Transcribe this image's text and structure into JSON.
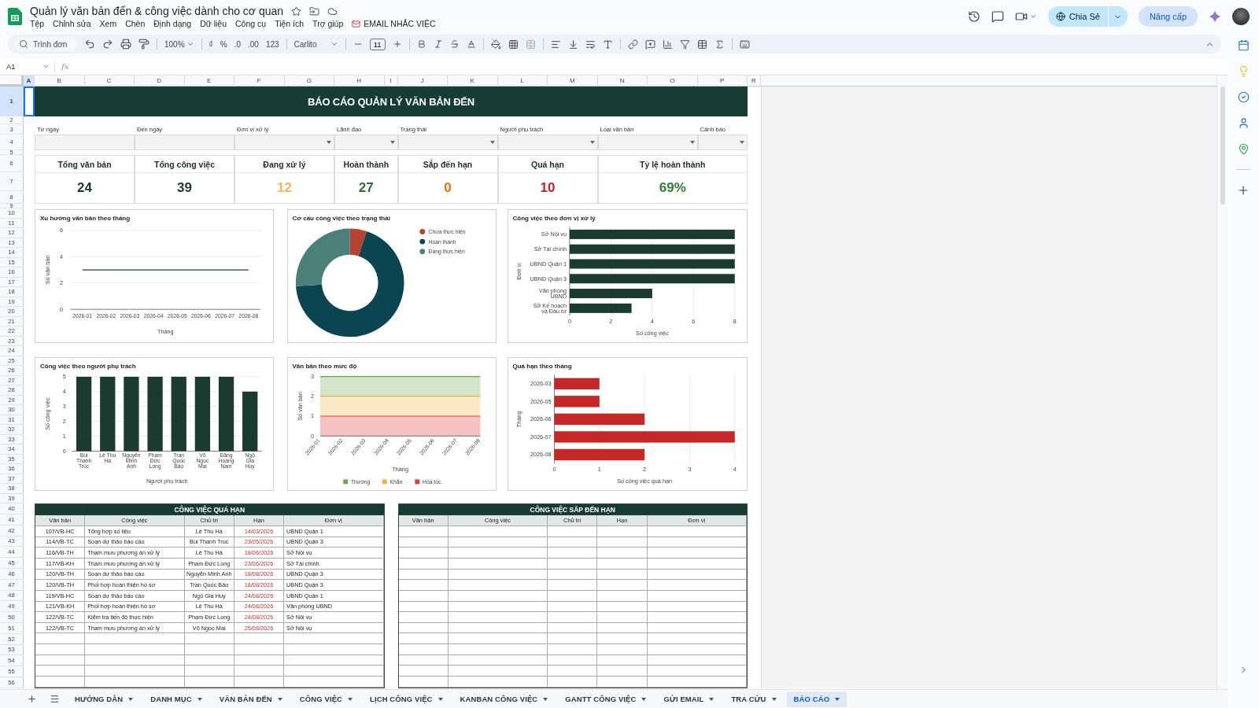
{
  "app": {
    "title": "Quản lý văn bản đến & công việc dành cho cơ quan",
    "share_label": "Chia Sẻ",
    "upgrade_label": "Nâng cấp"
  },
  "menu": [
    {
      "label": "Tệp",
      "kind": "menu"
    },
    {
      "label": "Chỉnh sửa",
      "kind": "menu"
    },
    {
      "label": "Xem",
      "kind": "menu"
    },
    {
      "label": "Chèn",
      "kind": "menu"
    },
    {
      "label": "Định dạng",
      "kind": "menu"
    },
    {
      "label": "Dữ liệu",
      "kind": "menu"
    },
    {
      "label": "Công cụ",
      "kind": "menu"
    },
    {
      "label": "Tiện ích",
      "kind": "menu"
    },
    {
      "label": "Trợ giúp",
      "kind": "menu"
    },
    {
      "label": "EMAIL NHẮC VIỆC",
      "kind": "addon"
    }
  ],
  "toolbar": {
    "search_placeholder": "Trình đơn",
    "zoom": "100%",
    "currency": "₫",
    "percent": "%",
    "decrease_decimals": ".0",
    "increase_decimals": ".00",
    "number_format": "123",
    "font": "Carlito",
    "font_size": "11"
  },
  "formula_bar": {
    "cell_ref": "A1",
    "fx": "fx"
  },
  "columns": [
    {
      "label": "A",
      "selected": true
    },
    {
      "label": "B",
      "selected": false
    },
    {
      "label": "C",
      "selected": false
    },
    {
      "label": "D",
      "selected": false
    },
    {
      "label": "E",
      "selected": false
    },
    {
      "label": "F",
      "selected": false
    },
    {
      "label": "G",
      "selected": false
    },
    {
      "label": "H",
      "selected": false
    },
    {
      "label": "I",
      "selected": false
    },
    {
      "label": "J",
      "selected": false
    },
    {
      "label": "K",
      "selected": false
    },
    {
      "label": "L",
      "selected": false
    },
    {
      "label": "M",
      "selected": false
    },
    {
      "label": "N",
      "selected": false
    },
    {
      "label": "O",
      "selected": false
    },
    {
      "label": "P",
      "selected": false
    },
    {
      "label": "R",
      "selected": false
    }
  ],
  "rows": [
    {
      "label": "1",
      "selected": true
    },
    {
      "label": "2",
      "selected": false
    },
    {
      "label": "3",
      "selected": false
    },
    {
      "label": "4",
      "selected": false
    },
    {
      "label": "5",
      "selected": false
    },
    {
      "label": "6",
      "selected": false
    },
    {
      "label": "7",
      "selected": false
    },
    {
      "label": "8",
      "selected": false
    },
    {
      "label": "9",
      "selected": false
    },
    {
      "label": "10",
      "selected": false
    },
    {
      "label": "11",
      "selected": false
    },
    {
      "label": "12",
      "selected": false
    },
    {
      "label": "13",
      "selected": false
    },
    {
      "label": "14",
      "selected": false
    },
    {
      "label": "15",
      "selected": false
    },
    {
      "label": "16",
      "selected": false
    },
    {
      "label": "17",
      "selected": false
    },
    {
      "label": "18",
      "selected": false
    },
    {
      "label": "19",
      "selected": false
    },
    {
      "label": "20",
      "selected": false
    },
    {
      "label": "21",
      "selected": false
    },
    {
      "label": "22",
      "selected": false
    },
    {
      "label": "23",
      "selected": false
    },
    {
      "label": "24",
      "selected": false
    },
    {
      "label": "25",
      "selected": false
    },
    {
      "label": "26",
      "selected": false
    },
    {
      "label": "27",
      "selected": false
    },
    {
      "label": "28",
      "selected": false
    },
    {
      "label": "29",
      "selected": false
    },
    {
      "label": "30",
      "selected": false
    },
    {
      "label": "31",
      "selected": false
    },
    {
      "label": "32",
      "selected": false
    },
    {
      "label": "33",
      "selected": false
    },
    {
      "label": "34",
      "selected": false
    },
    {
      "label": "35",
      "selected": false
    },
    {
      "label": "36",
      "selected": false
    },
    {
      "label": "37",
      "selected": false
    },
    {
      "label": "38",
      "selected": false
    },
    {
      "label": "39",
      "selected": false
    },
    {
      "label": "40",
      "selected": false
    },
    {
      "label": "41",
      "selected": false
    },
    {
      "label": "42",
      "selected": false
    },
    {
      "label": "43",
      "selected": false
    },
    {
      "label": "44",
      "selected": false
    },
    {
      "label": "45",
      "selected": false
    },
    {
      "label": "46",
      "selected": false
    },
    {
      "label": "47",
      "selected": false
    },
    {
      "label": "48",
      "selected": false
    },
    {
      "label": "49",
      "selected": false
    },
    {
      "label": "50",
      "selected": false
    },
    {
      "label": "51",
      "selected": false
    },
    {
      "label": "52",
      "selected": false
    },
    {
      "label": "53",
      "selected": false
    },
    {
      "label": "54",
      "selected": false
    },
    {
      "label": "55",
      "selected": false
    },
    {
      "label": "56",
      "selected": false
    }
  ],
  "report": {
    "title": "BÁO CÁO QUẢN LÝ VĂN BẢN ĐẾN",
    "filters": [
      {
        "label": "Từ ngày",
        "kind": "text"
      },
      {
        "label": "Đến ngày",
        "kind": "text"
      },
      {
        "label": "Đơn vị xử lý",
        "kind": "dropdown"
      },
      {
        "label": "Lãnh đạo",
        "kind": "dropdown"
      },
      {
        "label": "Trạng thái",
        "kind": "dropdown"
      },
      {
        "label": "Người phụ trách",
        "kind": "dropdown"
      },
      {
        "label": "Loại văn bản",
        "kind": "dropdown"
      },
      {
        "label": "Cảnh báo",
        "kind": "dropdown"
      }
    ],
    "kpis": [
      {
        "label": "Tổng văn bản",
        "value": "24",
        "color": "#1c3a30"
      },
      {
        "label": "Tổng công việc",
        "value": "39",
        "color": "#1c3a30"
      },
      {
        "label": "Đang xử lý",
        "value": "12",
        "color": "#f4b366"
      },
      {
        "label": "Hoàn thành",
        "value": "27",
        "color": "#2e6b35"
      },
      {
        "label": "Sắp đến hạn",
        "value": "0",
        "color": "#e8710a"
      },
      {
        "label": "Quá hạn",
        "value": "10",
        "color": "#c5221f"
      },
      {
        "label": "Tỷ lệ hoàn thành",
        "value": "69%",
        "color": "#2e7d32"
      }
    ],
    "charts": [
      {
        "chart_data": {
          "type": "line",
          "title": "Xu hướng văn bản theo tháng",
          "xlabel": "Tháng",
          "ylabel": "Số văn bản",
          "categories": [
            "2026-01",
            "2026-02",
            "2026-03",
            "2026-04",
            "2026-05",
            "2026-06",
            "2026-07",
            "2026-08"
          ],
          "series": [
            {
              "color": "#1e3d32",
              "values": [
                3,
                3,
                3,
                3,
                3,
                3,
                3,
                3
              ]
            }
          ],
          "ylim": [
            0,
            6
          ],
          "yticks": [
            0,
            2,
            4,
            6
          ],
          "grid": true
        }
      },
      {
        "chart_data": {
          "type": "donut",
          "title": "Cơ cấu công việc theo trạng thái",
          "categories": [
            "Chưa thực hiện",
            "Hoàn thành",
            "Đang thực hiện"
          ],
          "values": [
            5,
            69,
            26
          ],
          "colors": [
            "#b5432f",
            "#0b4551",
            "#4a7f7a"
          ],
          "legend": "right"
        }
      },
      {
        "chart_data": {
          "type": "bar",
          "orientation": "horizontal",
          "title": "Công việc theo đơn vị xử lý",
          "xlabel": "Số công việc",
          "ylabel": "Đơn vị",
          "categories": [
            "Sở Nội vụ",
            "Sở Tài chính",
            "UBND Quận 1",
            "UBND Quận 3",
            "Văn phòng UBND",
            "Sở Kế hoạch và Đầu tư"
          ],
          "series": [
            {
              "color": "#1b3a30",
              "values": [
                8,
                8,
                8,
                8,
                4,
                3
              ]
            }
          ],
          "xlim": [
            0,
            8
          ],
          "xticks": [
            0,
            2,
            4,
            6,
            8
          ],
          "grid": true
        }
      },
      {
        "chart_data": {
          "type": "bar",
          "orientation": "vertical",
          "title": "Công việc theo người phụ trách",
          "xlabel": "Người phụ trách",
          "ylabel": "Số công việc",
          "categories": [
            "Bùi Thanh Trúc",
            "Lê Thu Hà",
            "Nguyễn Minh Anh",
            "Phạm Đức Long",
            "Trần Quốc Bảo",
            "Võ Ngọc Mai",
            "Đặng Hoàng Nam",
            "Ngô Gia Huy"
          ],
          "series": [
            {
              "color": "#1b3a30",
              "values": [
                5,
                5,
                5,
                5,
                5,
                5,
                5,
                4
              ]
            }
          ],
          "ylim": [
            0,
            5
          ],
          "yticks": [
            0,
            1,
            2,
            3,
            4,
            5
          ],
          "grid": true
        }
      },
      {
        "chart_data": {
          "type": "area",
          "stacked": true,
          "title": "Văn bản theo mức độ",
          "xlabel": "Tháng",
          "ylabel": "Số văn bản",
          "categories": [
            "2026-01",
            "2026-02",
            "2026-03",
            "2026-04",
            "2026-05",
            "2026-06",
            "2026-07",
            "2026-08"
          ],
          "series": [
            {
              "name": "Thường",
              "color": "#6aa84f",
              "values": [
                1,
                1,
                1,
                1,
                1,
                1,
                1,
                1
              ]
            },
            {
              "name": "Khẩn",
              "color": "#f1b33b",
              "values": [
                1,
                1,
                1,
                1,
                1,
                1,
                1,
                1
              ]
            },
            {
              "name": "Hỏa tốc",
              "color": "#e53935",
              "values": [
                1,
                1,
                1,
                1,
                1,
                1,
                1,
                1
              ]
            }
          ],
          "ylim": [
            0,
            3
          ],
          "yticks": [
            0,
            1,
            2,
            3
          ],
          "grid": true,
          "legend": "bottom"
        }
      },
      {
        "chart_data": {
          "type": "bar",
          "orientation": "horizontal",
          "title": "Quá hạn theo tháng",
          "xlabel": "Số công việc quá hạn",
          "ylabel": "Tháng",
          "categories": [
            "2026-03",
            "2026-05",
            "2026-06",
            "2026-07",
            "2026-08"
          ],
          "series": [
            {
              "color": "#c62828",
              "values": [
                1,
                1,
                2,
                4,
                2
              ]
            }
          ],
          "xlim": [
            0,
            4
          ],
          "xticks": [
            0,
            1,
            2,
            3,
            4
          ],
          "grid": true
        }
      }
    ],
    "tables": [
      {
        "title": "CÔNG VIỆC QUÁ HẠN",
        "columns": [
          "Văn bản",
          "Công việc",
          "Chủ trì",
          "Hạn",
          "Đơn vị"
        ],
        "rows": [
          [
            "107/VB-HC",
            "Tổng hợp số liệu",
            "Lê Thu Hà",
            "14/03/2026",
            "UBND Quận 1"
          ],
          [
            "114/VB-TC",
            "Soạn dự thảo báo cáo",
            "Bùi Thanh Trúc",
            "23/05/2026",
            "UBND Quận 3"
          ],
          [
            "116/VB-TH",
            "Tham mưu phương án xử lý",
            "Lê Thu Hà",
            "18/06/2026",
            "Sở Nội vụ"
          ],
          [
            "117/VB-KH",
            "Tham mưu phương án xử lý",
            "Phạm Đức Long",
            "23/06/2026",
            "Sở Tài chính"
          ],
          [
            "120/VB-TH",
            "Soạn dự thảo báo cáo",
            "Nguyễn Minh Anh",
            "18/08/2026",
            "UBND Quận 3"
          ],
          [
            "120/VB-TH",
            "Phối hợp hoàn thiện hồ sơ",
            "Trần Quốc Bảo",
            "18/08/2026",
            "UBND Quận 3"
          ],
          [
            "119/VB-HC",
            "Soạn dự thảo báo cáo",
            "Ngô Gia Huy",
            "24/08/2026",
            "UBND Quận 1"
          ],
          [
            "121/VB-KH",
            "Phối hợp hoàn thiện hồ sơ",
            "Lê Thu Hà",
            "24/08/2026",
            "Văn phòng UBND"
          ],
          [
            "122/VB-TC",
            "Kiểm tra tiến độ thực hiện",
            "Phạm Đức Long",
            "24/08/2026",
            "Sở Nội vụ"
          ],
          [
            "122/VB-TC",
            "Tham mưu phương án xử lý",
            "Võ Ngọc Mai",
            "25/08/2026",
            "Sở Nội vụ"
          ]
        ]
      },
      {
        "title": "CÔNG VIỆC SẮP ĐẾN HẠN",
        "columns": [
          "Văn bản",
          "Công việc",
          "Chủ trì",
          "Hạn",
          "Đơn vị"
        ]
      }
    ]
  },
  "sheet_tabs": [
    {
      "label": "HƯỚNG DẪN",
      "selected": false
    },
    {
      "label": "DANH MỤC",
      "selected": false
    },
    {
      "label": "VĂN BẢN ĐẾN",
      "selected": false
    },
    {
      "label": "CÔNG VIỆC",
      "selected": false
    },
    {
      "label": "LỊCH CÔNG VIỆC",
      "selected": false
    },
    {
      "label": "KANBAN CÔNG VIỆC",
      "selected": false
    },
    {
      "label": "GANTT CÔNG VIỆC",
      "selected": false
    },
    {
      "label": "GỬI EMAIL",
      "selected": false
    },
    {
      "label": "TRA CỨU",
      "selected": false
    },
    {
      "label": "BÁO CÁO",
      "selected": true
    }
  ]
}
